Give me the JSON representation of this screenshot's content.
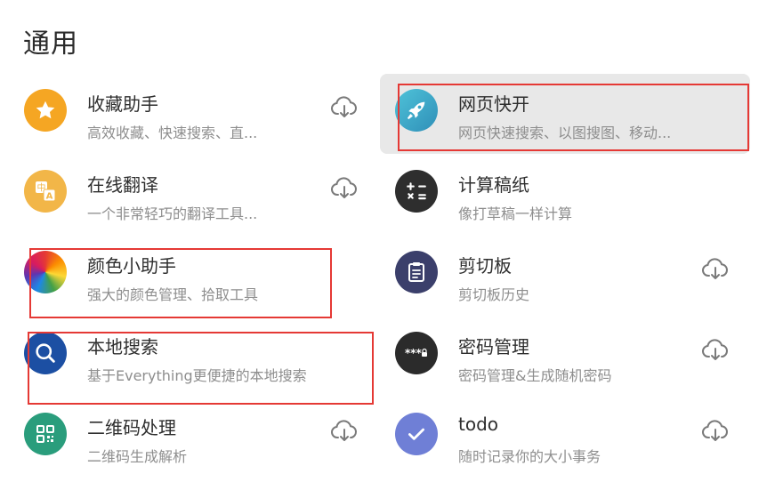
{
  "section": {
    "title": "通用"
  },
  "apps": [
    {
      "name": "收藏助手",
      "desc": "高效收藏、快速搜索、直...",
      "icon": "star-icon",
      "color": "#f5a623",
      "download": true
    },
    {
      "name": "网页快开",
      "desc": "网页快速搜索、以图搜图、移动...",
      "icon": "rocket-icon",
      "color": "#3aa7c9",
      "download": false,
      "active": true
    },
    {
      "name": "在线翻译",
      "desc": "一个非常轻巧的翻译工具...",
      "icon": "translate-icon",
      "color": "#f2b648",
      "download": true
    },
    {
      "name": "计算稿纸",
      "desc": "像打草稿一样计算",
      "icon": "calculator-icon",
      "color": "#2e2e2e",
      "download": false
    },
    {
      "name": "颜色小助手",
      "desc": "强大的颜色管理、拾取工具",
      "icon": "color-wheel-icon",
      "color": "#e53935",
      "download": false
    },
    {
      "name": "剪切板",
      "desc": "剪切板历史",
      "icon": "clipboard-icon",
      "color": "#3b3f6b",
      "download": true
    },
    {
      "name": "本地搜索",
      "desc": "基于Everything更便捷的本地搜索",
      "icon": "search-icon",
      "color": "#1c4fa3",
      "download": false
    },
    {
      "name": "密码管理",
      "desc": "密码管理&生成随机密码",
      "icon": "password-icon",
      "color": "#2b2b2b",
      "download": true
    },
    {
      "name": "二维码处理",
      "desc": "二维码生成解析",
      "icon": "qrcode-icon",
      "color": "#2a9d7c",
      "download": true
    },
    {
      "name": "todo",
      "desc": "随时记录你的大小事务",
      "icon": "check-icon",
      "color": "#6f7fd6",
      "download": true
    }
  ],
  "highlight_color": "#e53935"
}
